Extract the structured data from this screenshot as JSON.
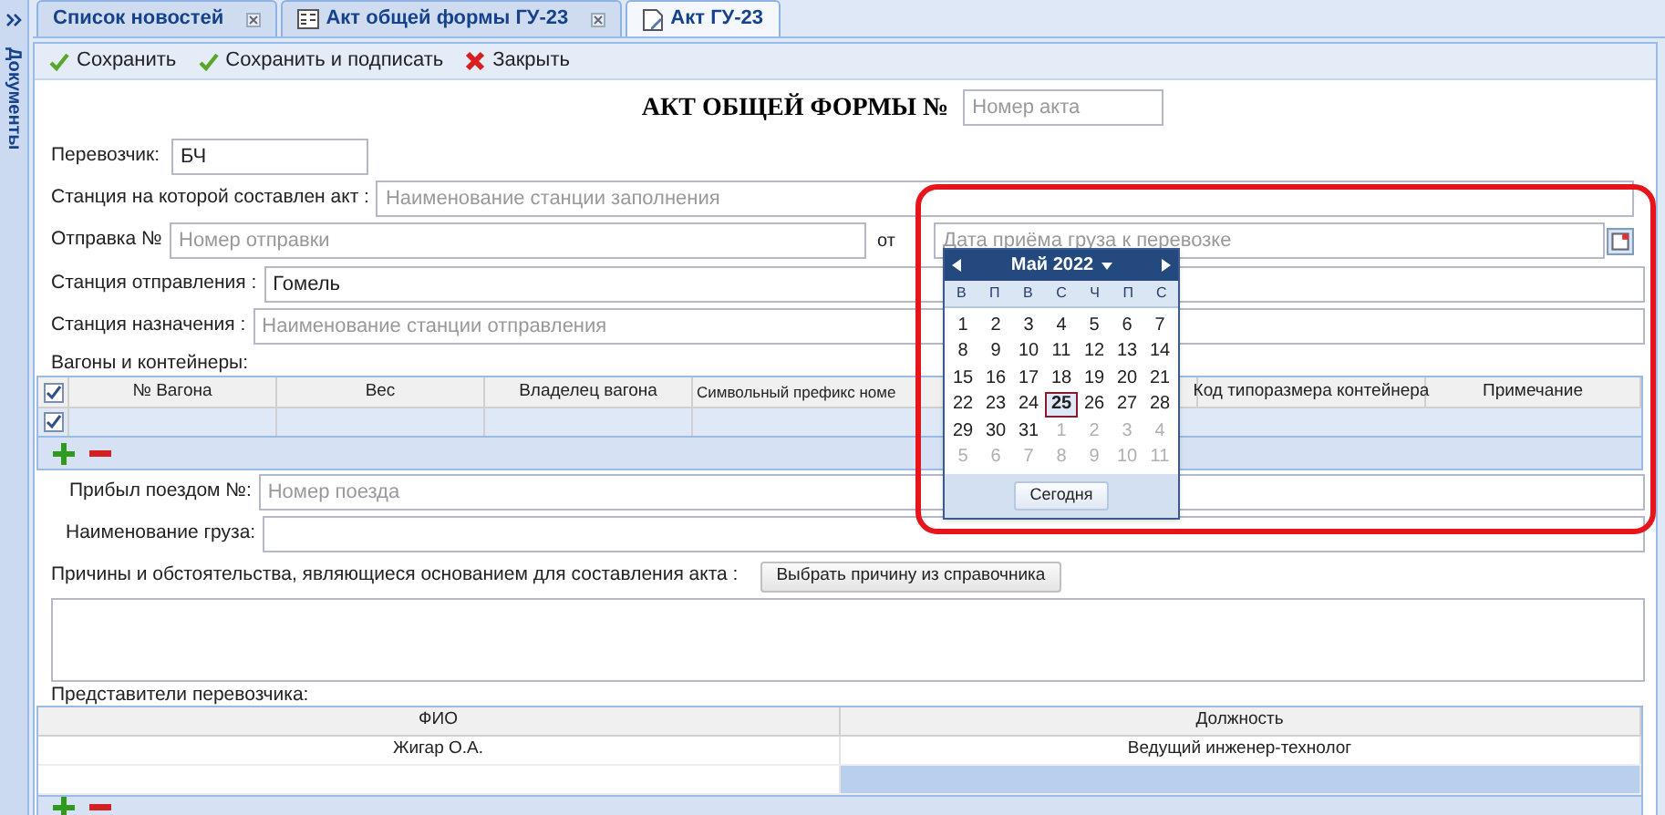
{
  "sidebar": {
    "title": "Документы"
  },
  "tabs": [
    {
      "label": "Список новостей",
      "selected": false,
      "closable": true
    },
    {
      "label": "Акт общей формы ГУ-23",
      "selected": false,
      "closable": true
    },
    {
      "label": "Акт ГУ-23",
      "selected": true,
      "closable": false
    }
  ],
  "toolbar": [
    {
      "label": "Сохранить",
      "kind": "save"
    },
    {
      "label": "Сохранить и подписать",
      "kind": "save"
    },
    {
      "label": "Закрыть",
      "kind": "close"
    }
  ],
  "title": "АКТ ОБЩЕЙ ФОРМЫ №",
  "act_number": {
    "placeholder": "Номер акта"
  },
  "carrier": {
    "label": "Перевозчик:",
    "value": "БЧ"
  },
  "station_made": {
    "label": "Станция на которой составлен акт :",
    "placeholder": "Наименование станции заполнения"
  },
  "shipment": {
    "label": "Отправка №",
    "placeholder": "Номер отправки"
  },
  "date": {
    "label": "от",
    "placeholder": "Дата приёма груза к перевозке"
  },
  "departure": {
    "label": "Станция отправления :",
    "value": "Гомель"
  },
  "destination": {
    "label": "Станция назначения :",
    "placeholder": "Наименование станции отправления"
  },
  "wagons": {
    "title": "Вагоны и контейнеры:",
    "header_checked": true,
    "columns": [
      "№ Вагона",
      "Вес",
      "Владелец вагона",
      "Символьный префикс номе",
      "Код типоразмера контейнера",
      "Примечание"
    ],
    "rows": [
      {
        "checked": true,
        "selected": true
      }
    ]
  },
  "train": {
    "label": "Прибыл поездом №:",
    "placeholder": "Номер поезда"
  },
  "cargo": {
    "label": "Наименование груза:"
  },
  "reasons": {
    "label": "Причины и обстоятельства, являющиеся основанием для составления акта :",
    "button": "Выбрать причину из справочника"
  },
  "representatives": {
    "title": "Представители перевозчика:",
    "columns": [
      "ФИО",
      "Должность"
    ],
    "rows": [
      {
        "cells": [
          {
            "text": "Жигар О.А.",
            "selected": false
          },
          {
            "text": "Ведущий инженер-технолог",
            "selected": false
          }
        ]
      },
      {
        "cells": [
          {
            "selected": false
          },
          {
            "selected": true
          }
        ]
      }
    ]
  },
  "calendar": {
    "month": "Май 2022",
    "weekdays": [
      "В",
      "П",
      "В",
      "С",
      "Ч",
      "П",
      "С"
    ],
    "today_button": "Сегодня",
    "days": [
      {
        "label": "1",
        "other_month": false,
        "selected": false
      },
      {
        "label": "2",
        "other_month": false,
        "selected": false
      },
      {
        "label": "3",
        "other_month": false,
        "selected": false
      },
      {
        "label": "4",
        "other_month": false,
        "selected": false
      },
      {
        "label": "5",
        "other_month": false,
        "selected": false
      },
      {
        "label": "6",
        "other_month": false,
        "selected": false
      },
      {
        "label": "7",
        "other_month": false,
        "selected": false
      },
      {
        "label": "8",
        "other_month": false,
        "selected": false
      },
      {
        "label": "9",
        "other_month": false,
        "selected": false
      },
      {
        "label": "10",
        "other_month": false,
        "selected": false
      },
      {
        "label": "11",
        "other_month": false,
        "selected": false
      },
      {
        "label": "12",
        "other_month": false,
        "selected": false
      },
      {
        "label": "13",
        "other_month": false,
        "selected": false
      },
      {
        "label": "14",
        "other_month": false,
        "selected": false
      },
      {
        "label": "15",
        "other_month": false,
        "selected": false
      },
      {
        "label": "16",
        "other_month": false,
        "selected": false
      },
      {
        "label": "17",
        "other_month": false,
        "selected": false
      },
      {
        "label": "18",
        "other_month": false,
        "selected": false
      },
      {
        "label": "19",
        "other_month": false,
        "selected": false
      },
      {
        "label": "20",
        "other_month": false,
        "selected": false
      },
      {
        "label": "21",
        "other_month": false,
        "selected": false
      },
      {
        "label": "22",
        "other_month": false,
        "selected": false
      },
      {
        "label": "23",
        "other_month": false,
        "selected": false
      },
      {
        "label": "24",
        "other_month": false,
        "selected": false
      },
      {
        "label": "25",
        "other_month": false,
        "selected": true
      },
      {
        "label": "26",
        "other_month": false,
        "selected": false
      },
      {
        "label": "27",
        "other_month": false,
        "selected": false
      },
      {
        "label": "28",
        "other_month": false,
        "selected": false
      },
      {
        "label": "29",
        "other_month": false,
        "selected": false
      },
      {
        "label": "30",
        "other_month": false,
        "selected": false
      },
      {
        "label": "31",
        "other_month": false,
        "selected": false
      },
      {
        "label": "1",
        "other_month": true,
        "selected": false
      },
      {
        "label": "2",
        "other_month": true,
        "selected": false
      },
      {
        "label": "3",
        "other_month": true,
        "selected": false
      },
      {
        "label": "4",
        "other_month": true,
        "selected": false
      },
      {
        "label": "5",
        "other_month": true,
        "selected": false
      },
      {
        "label": "6",
        "other_month": true,
        "selected": false
      },
      {
        "label": "7",
        "other_month": true,
        "selected": false
      },
      {
        "label": "8",
        "other_month": true,
        "selected": false
      },
      {
        "label": "9",
        "other_month": true,
        "selected": false
      },
      {
        "label": "10",
        "other_month": true,
        "selected": false
      },
      {
        "label": "11",
        "other_month": true,
        "selected": false
      }
    ]
  }
}
